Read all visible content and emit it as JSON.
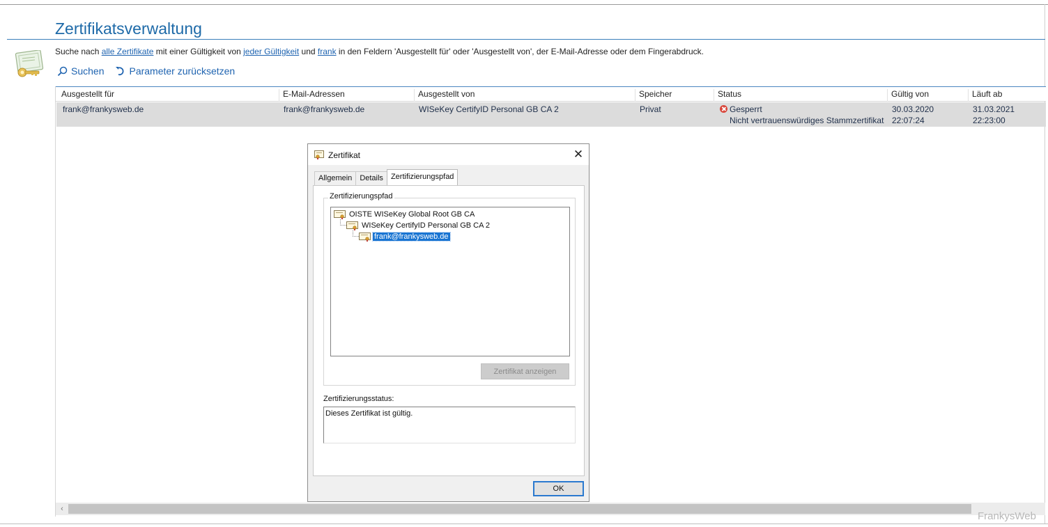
{
  "page": {
    "title": "Zertifikatsverwaltung",
    "search": {
      "prefix": "Suche nach ",
      "link_certificates": "alle Zertifikate",
      "mid1": " mit einer Gültigkeit von ",
      "link_validity": "jeder Gültigkeit",
      "mid2": " und ",
      "link_term": "frank",
      "suffix": " in den Feldern 'Ausgestellt für' oder 'Ausgestellt von', der E-Mail-Adresse oder dem Fingerabdruck."
    },
    "toolbar": {
      "search_label": "Suchen",
      "reset_label": "Parameter zurücksetzen"
    }
  },
  "grid": {
    "columns": [
      "Ausgestellt für",
      "E-Mail-Adressen",
      "Ausgestellt von",
      "Speicher",
      "Status",
      "Gültig von",
      "Läuft ab"
    ],
    "rows": [
      {
        "issued_to": "frank@frankysweb.de",
        "email": "frank@frankysweb.de",
        "issued_by": "WISeKey CertifyID Personal GB CA 2",
        "store": "Privat",
        "status": "Gesperrt",
        "status_detail": "Nicht vertrauenswürdiges Stammzertifikat",
        "valid_from_date": "30.03.2020",
        "valid_from_time": "22:07:24",
        "expires_date": "31.03.2021",
        "expires_time": "22:23:00"
      }
    ]
  },
  "dialog": {
    "title": "Zertifikat",
    "tabs": [
      "Allgemein",
      "Details",
      "Zertifizierungspfad"
    ],
    "active_tab": "Zertifizierungspfad",
    "path_group_label": "Zertifizierungspfad",
    "path": [
      {
        "label": "OISTE WISeKey Global Root GB CA"
      },
      {
        "label": "WISeKey CertifyID Personal GB CA 2"
      },
      {
        "label": "frank@frankysweb.de"
      }
    ],
    "view_button": "Zertifikat anzeigen",
    "status_label": "Zertifizierungsstatus:",
    "status_text": "Dieses Zertifikat ist gültig.",
    "ok_button": "OK"
  },
  "watermark": "FrankysWeb",
  "colors": {
    "accent": "#1e6aa8",
    "link": "#1e63b0",
    "row_selected": "#dcdcdc",
    "tree_selected": "#1874d2",
    "status_error": "#d9463a"
  }
}
